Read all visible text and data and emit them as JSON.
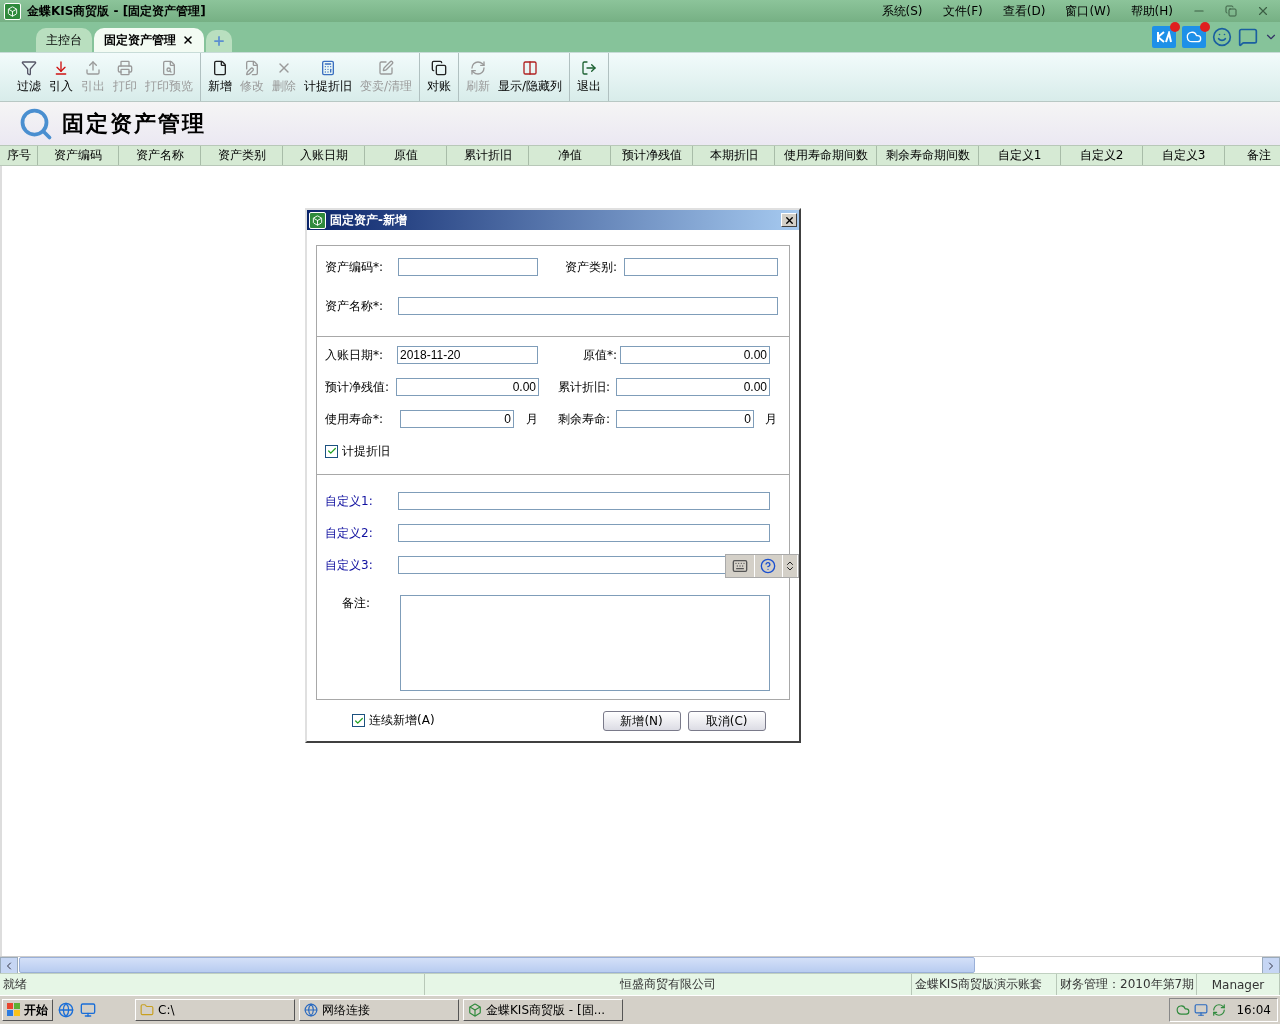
{
  "window": {
    "title": "金蝶KIS商贸版 - [固定资产管理]"
  },
  "menu": [
    "系统(S)",
    "文件(F)",
    "查看(D)",
    "窗口(W)",
    "帮助(H)"
  ],
  "tabs": [
    {
      "label": "主控台",
      "selected": false,
      "closable": false
    },
    {
      "label": "固定资产管理",
      "selected": true,
      "closable": true
    }
  ],
  "toolbar": [
    [
      {
        "label": "过滤",
        "disabled": false
      },
      {
        "label": "引入",
        "disabled": false
      },
      {
        "label": "引出",
        "disabled": true
      },
      {
        "label": "打印",
        "disabled": true
      },
      {
        "label": "打印预览",
        "disabled": true
      }
    ],
    [
      {
        "label": "新增",
        "disabled": false
      },
      {
        "label": "修改",
        "disabled": true
      },
      {
        "label": "删除",
        "disabled": true
      },
      {
        "label": "计提折旧",
        "disabled": false
      },
      {
        "label": "变卖/清理",
        "disabled": true
      }
    ],
    [
      {
        "label": "对账",
        "disabled": false
      }
    ],
    [
      {
        "label": "刷新",
        "disabled": true
      },
      {
        "label": "显示/隐藏列",
        "disabled": false
      }
    ],
    [
      {
        "label": "退出",
        "disabled": false
      }
    ]
  ],
  "page_title": "固定资产管理",
  "table": {
    "columns": [
      "序号",
      "资产编码",
      "资产名称",
      "资产类别",
      "入账日期",
      "原值",
      "累计折旧",
      "净值",
      "预计净残值",
      "本期折旧",
      "使用寿命期间数",
      "剩余寿命期间数",
      "自定义1",
      "自定义2",
      "自定义3",
      "备注"
    ]
  },
  "dialog": {
    "title": "固定资产-新增",
    "fields": [
      {
        "label": "资产编码*:"
      },
      {
        "label": "资产类别:"
      },
      {
        "label": "资产名称*:"
      },
      {
        "label": "入账日期*:",
        "value": "2018-11-20"
      },
      {
        "label": "原值*:",
        "value": "0.00"
      },
      {
        "label": "预计净残值:",
        "value": "0.00"
      },
      {
        "label": "累计折旧:",
        "value": "0.00"
      },
      {
        "label": "使用寿命*:",
        "value": "0",
        "unit": "月"
      },
      {
        "label": "剩余寿命:",
        "value": "0",
        "unit": "月"
      }
    ],
    "depreciate": {
      "label": "计提折旧",
      "checked": true
    },
    "custom_fields": [
      "自定义1:",
      "自定义2:",
      "自定义3:"
    ],
    "remark": "备注:",
    "continuous": {
      "label": "连续新增(A)",
      "checked": true
    },
    "buttons": [
      "新增(N)",
      "取消(C)"
    ]
  },
  "status_bar": [
    "就绪",
    "恒盛商贸有限公司",
    "金蝶KIS商贸版演示账套",
    "财务管理：2010年第7期",
    "Manager"
  ],
  "taskbar": {
    "start": "开始",
    "windows": [
      "C:\\",
      "网络连接",
      "金蝶KIS商贸版 - [固..."
    ],
    "clock": "16:04"
  }
}
